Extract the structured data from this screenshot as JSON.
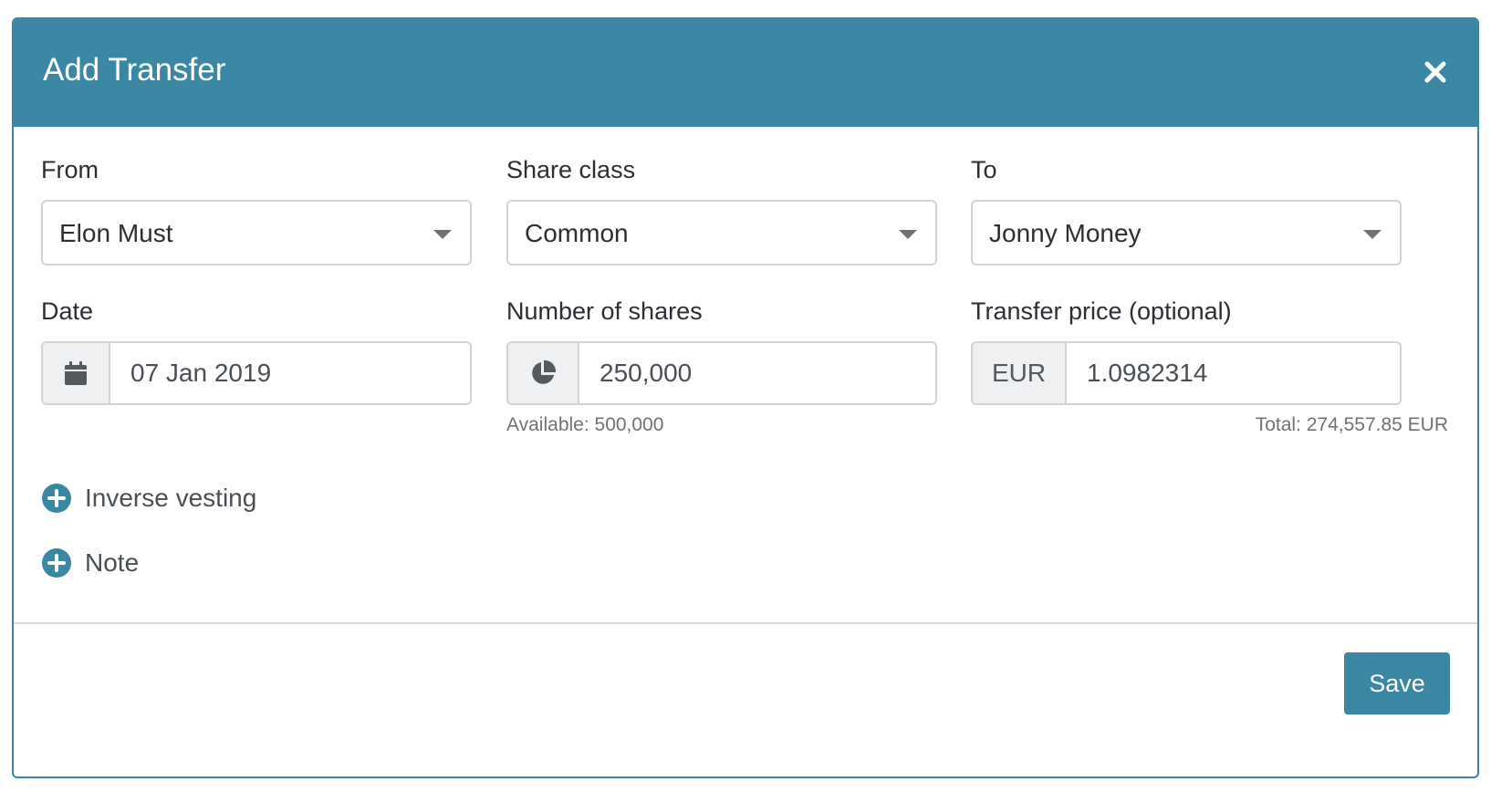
{
  "modal": {
    "title": "Add Transfer",
    "close_icon": "close-icon"
  },
  "fields": {
    "from": {
      "label": "From",
      "value": "Elon Must"
    },
    "share_class": {
      "label": "Share class",
      "value": "Common"
    },
    "to": {
      "label": "To",
      "value": "Jonny Money"
    },
    "date": {
      "label": "Date",
      "value": "07 Jan 2019",
      "icon": "calendar-icon"
    },
    "shares": {
      "label": "Number of shares",
      "value": "250,000",
      "icon": "pie-chart-icon",
      "help": "Available: 500,000"
    },
    "price": {
      "label": "Transfer price (optional)",
      "currency": "EUR",
      "value": "1.0982314",
      "help": "Total: 274,557.85 EUR"
    }
  },
  "expanders": {
    "inverse_vesting": {
      "label": "Inverse vesting",
      "icon": "plus-circle-icon"
    },
    "note": {
      "label": "Note",
      "icon": "plus-circle-icon"
    }
  },
  "footer": {
    "save_label": "Save"
  },
  "colors": {
    "accent": "#3a87a3",
    "border": "#cfd4d9",
    "addon_bg": "#eef0f2"
  }
}
